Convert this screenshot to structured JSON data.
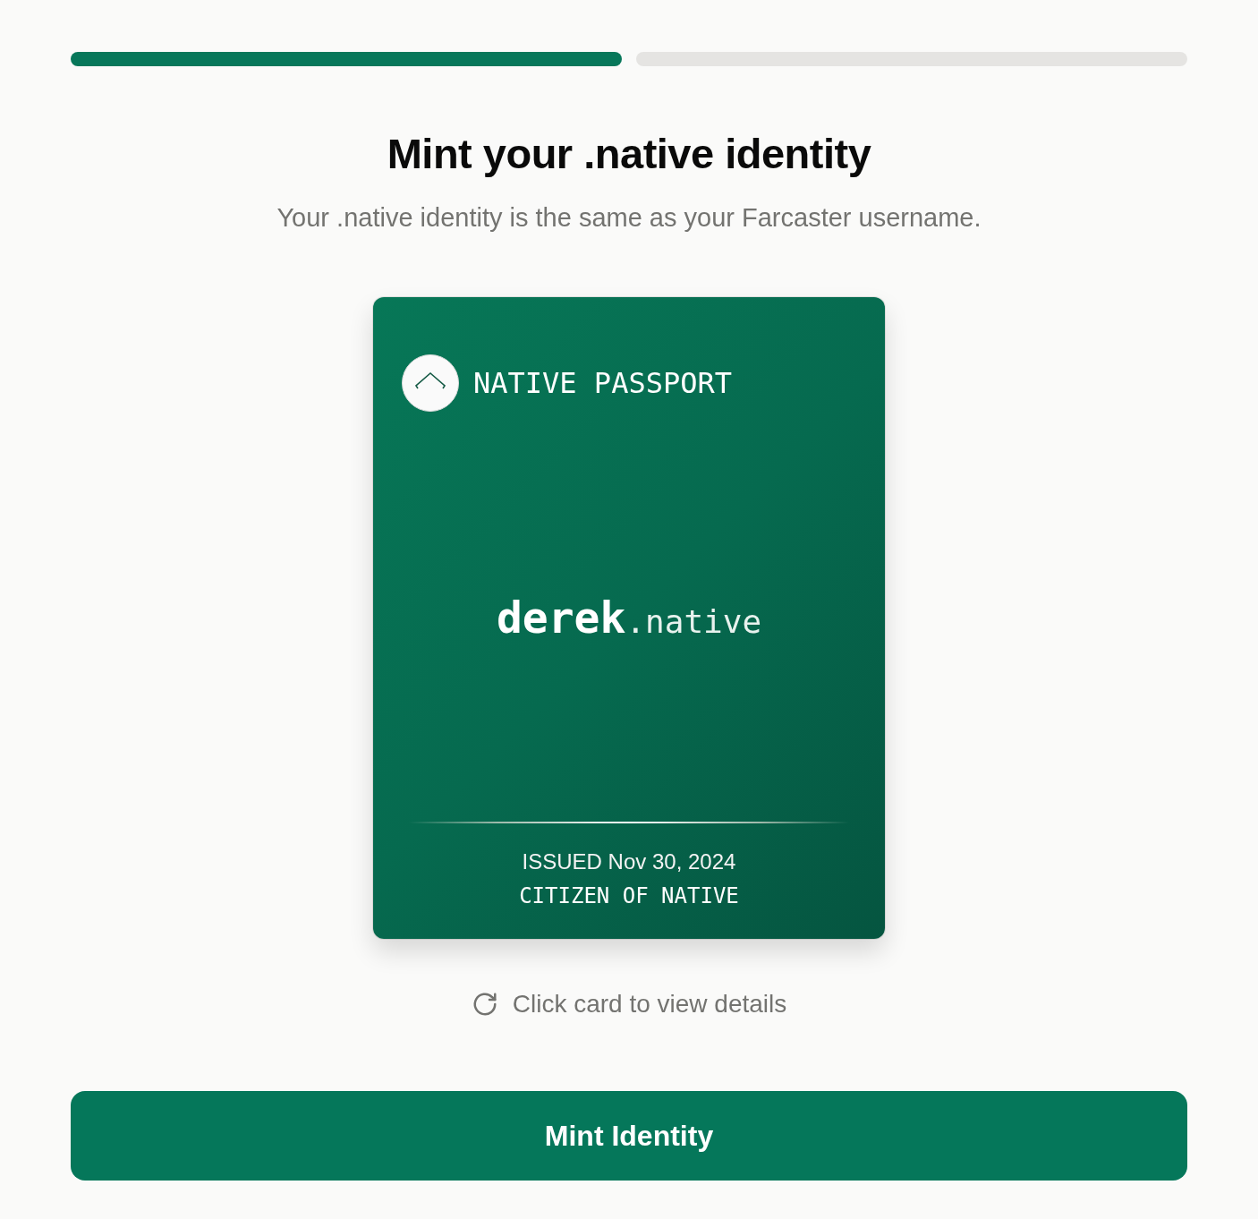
{
  "steps": [
    {
      "complete": true
    },
    {
      "complete": false
    }
  ],
  "heading": "Mint your .native identity",
  "subtitle": "Your .native identity is the same as your Farcaster username.",
  "passport": {
    "title": "NATIVE PASSPORT",
    "handle": "derek",
    "suffix": ".native",
    "issued": "ISSUED Nov 30, 2024",
    "status": "CITIZEN OF NATIVE"
  },
  "hint": "Click card to view details",
  "button": "Mint Identity"
}
